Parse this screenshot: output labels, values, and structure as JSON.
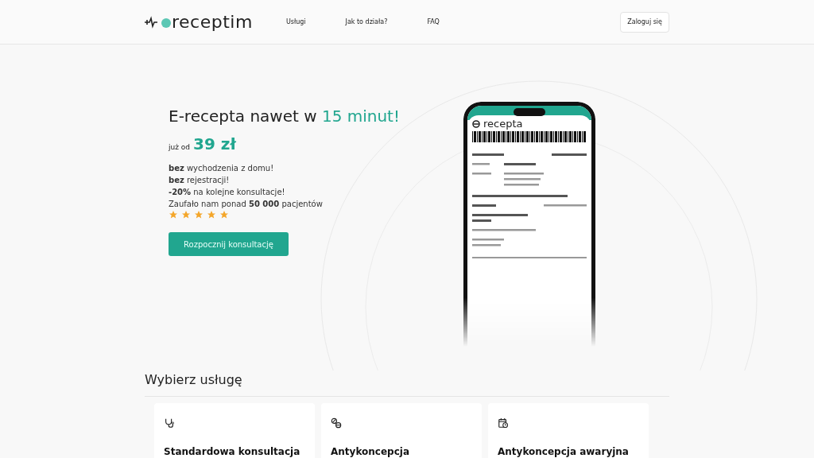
{
  "nav": {
    "logo": "receptim",
    "links": [
      {
        "label": "Usługi"
      },
      {
        "label": "Jak to działa?"
      },
      {
        "label": "FAQ"
      }
    ],
    "login": "Zaloguj się"
  },
  "hero": {
    "title": "E-recepta nawet w",
    "title_accent": "15 minut!",
    "price_prefix": "już od",
    "price": "39 zł",
    "points": [
      "**bez** wychodzenia z domu!",
      "**bez** rejestracji!",
      "**-20%** na kolejne konsultacje!",
      "Zaufało nam ponad **50 000** pacjentów"
    ],
    "stars": 5,
    "cta": "Rozpocznij konsultację"
  },
  "phone": {
    "logo": "recepta"
  },
  "services": {
    "heading": "Wybierz usługę",
    "items": [
      {
        "kind": "stethoscope",
        "title": "Standardowa konsultacja"
      },
      {
        "kind": "pills",
        "title": "Antykoncepcja"
      },
      {
        "kind": "calendar",
        "title": "Antykoncepcja awaryjna"
      }
    ]
  }
}
